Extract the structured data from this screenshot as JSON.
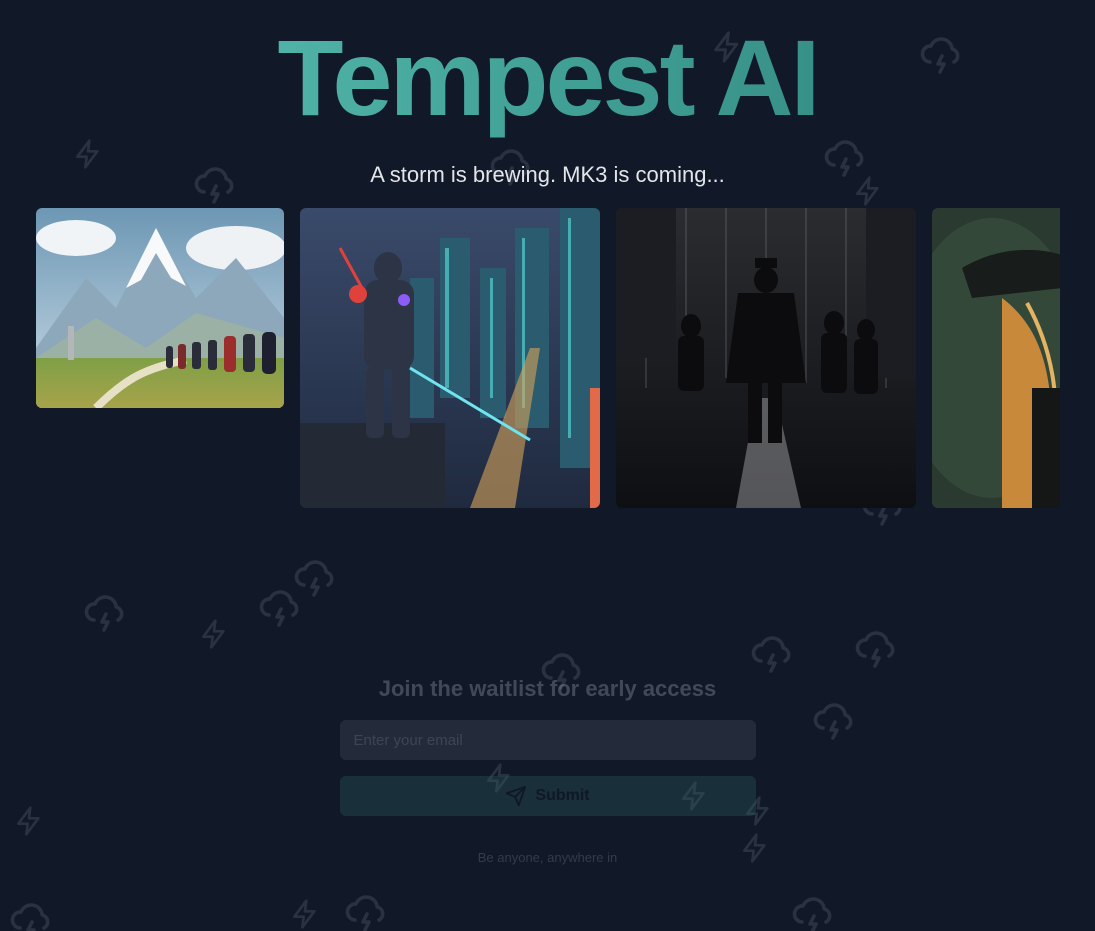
{
  "hero": {
    "title": "Tempest AI",
    "subtitle": "A storm is brewing. MK3 is coming..."
  },
  "gallery": {
    "images": [
      {
        "name": "mountain-procession-image",
        "alt": "mountain-procession"
      },
      {
        "name": "cyber-samurai-image",
        "alt": "cyber-samurai"
      },
      {
        "name": "noir-rain-image",
        "alt": "noir-rain"
      },
      {
        "name": "witch-portrait-image",
        "alt": "witch-portrait"
      }
    ]
  },
  "waitlist": {
    "heading": "Join the waitlist for early access",
    "email_placeholder": "Enter your email",
    "submit_label": "Submit",
    "submit_icon": "send-icon",
    "footnote": "Be anyone, anywhere in"
  },
  "background": {
    "icons": [
      "lightning-icon",
      "storm-cloud-icon"
    ]
  },
  "colors": {
    "background": "#111827",
    "accent_start": "#5ec4b6",
    "accent_end": "#2f7f78",
    "button": "#2b5f63"
  }
}
